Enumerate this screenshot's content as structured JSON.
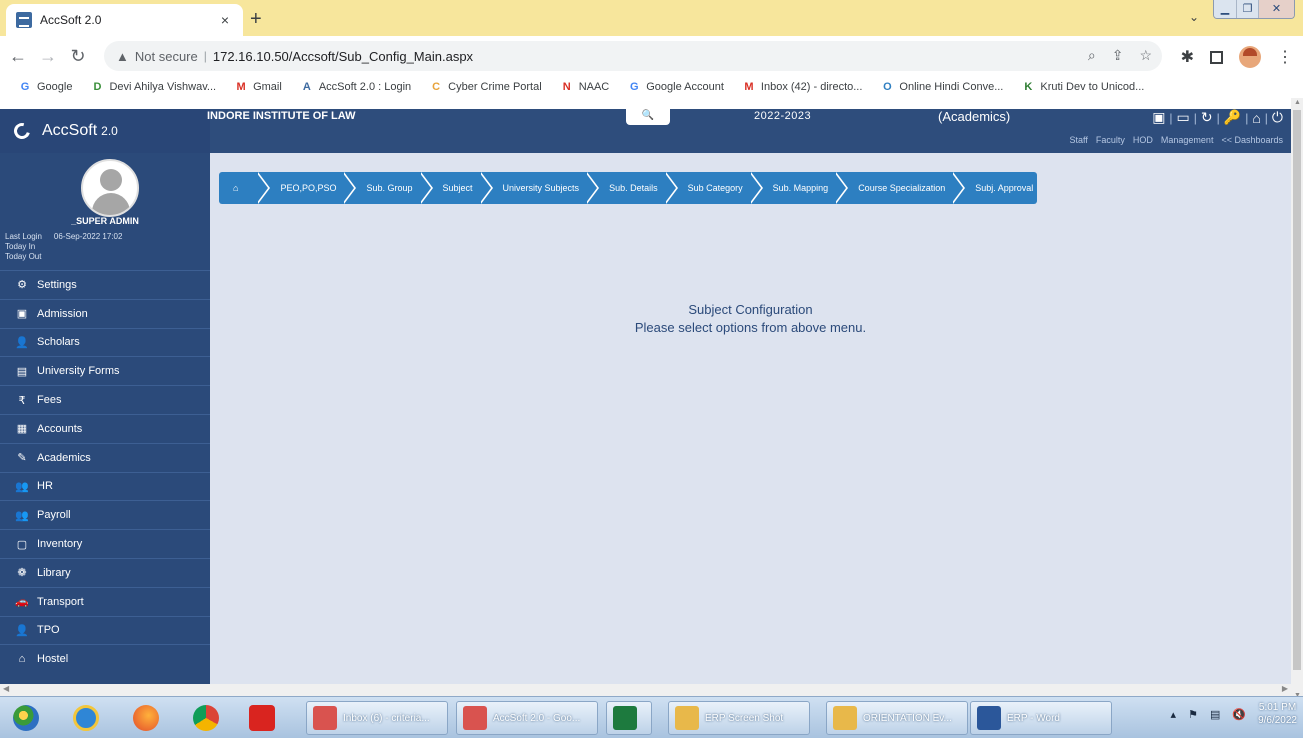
{
  "browser": {
    "tab_title": "AccSoft 2.0",
    "tab_close": "×",
    "new_tab": "+",
    "not_secure": "Not secure",
    "url": "172.16.10.50/Accsoft/Sub_Config_Main.aspx"
  },
  "bookmarks": [
    {
      "label": "Google",
      "icon": "G",
      "color": "#4285f4"
    },
    {
      "label": "Devi Ahilya Vishwav...",
      "icon": "D",
      "color": "#3a8f3a"
    },
    {
      "label": "Gmail",
      "icon": "M",
      "color": "#d93025"
    },
    {
      "label": "AccSoft 2.0 : Login",
      "icon": "A",
      "color": "#3d6aa0"
    },
    {
      "label": "Cyber Crime Portal",
      "icon": "C",
      "color": "#e8a33a"
    },
    {
      "label": "NAAC",
      "icon": "N",
      "color": "#d93025"
    },
    {
      "label": "Google Account",
      "icon": "G",
      "color": "#4285f4"
    },
    {
      "label": "Inbox (42) - directo...",
      "icon": "M",
      "color": "#d93025"
    },
    {
      "label": "Online Hindi Conve...",
      "icon": "O",
      "color": "#2f7fc1"
    },
    {
      "label": "Kruti Dev to Unicod...",
      "icon": "K",
      "color": "#2e7d32"
    }
  ],
  "header": {
    "app_name": "AccSoft",
    "app_version": "2.0",
    "institute": "INDORE INSTITUTE OF LAW",
    "session": "2022-2023",
    "module": "(Academics)",
    "dashboards": [
      "Staff",
      "Faculty",
      "HOD",
      "Management",
      "<< Dashboards"
    ]
  },
  "user": {
    "name": "_SUPER ADMIN",
    "last_login_label": "Last Login",
    "last_login_value": "06-Sep-2022 17:02",
    "today_in_label": "Today In",
    "today_out_label": "Today Out"
  },
  "sidebar": {
    "items": [
      {
        "label": "Settings",
        "icon": "settings-icon",
        "glyph": "⚙"
      },
      {
        "label": "Admission",
        "icon": "admission-icon",
        "glyph": "▣"
      },
      {
        "label": "Scholars",
        "icon": "user-icon",
        "glyph": "👤"
      },
      {
        "label": "University Forms",
        "icon": "form-icon",
        "glyph": "▤"
      },
      {
        "label": "Fees",
        "icon": "rupee-icon",
        "glyph": "₹"
      },
      {
        "label": "Accounts",
        "icon": "accounts-icon",
        "glyph": "▦"
      },
      {
        "label": "Academics",
        "icon": "pencil-icon",
        "glyph": "✎"
      },
      {
        "label": "HR",
        "icon": "users-icon",
        "glyph": "👥"
      },
      {
        "label": "Payroll",
        "icon": "users-icon",
        "glyph": "👥"
      },
      {
        "label": "Inventory",
        "icon": "inventory-icon",
        "glyph": "▢"
      },
      {
        "label": "Library",
        "icon": "library-icon",
        "glyph": "❁"
      },
      {
        "label": "Transport",
        "icon": "car-icon",
        "glyph": "🚗"
      },
      {
        "label": "TPO",
        "icon": "user-icon",
        "glyph": "👤"
      },
      {
        "label": "Hostel",
        "icon": "home-icon",
        "glyph": "⌂"
      }
    ]
  },
  "breadcrumbs": [
    "PEO,PO,PSO",
    "Sub. Group",
    "Subject",
    "University Subjects",
    "Sub. Details",
    "Sub Category",
    "Sub. Mapping",
    "Course Specialization",
    "Subj. Approval"
  ],
  "content": {
    "title": "Subject Configuration",
    "message": "Please select options from above menu."
  },
  "taskbar": {
    "tasks": [
      {
        "label": "Inbox (6) - criteria...",
        "color": "#d9534f"
      },
      {
        "label": "AccSoft 2.0 - Goo...",
        "color": "#d9534f"
      },
      {
        "label": "",
        "color": "#1d7a3e"
      },
      {
        "label": "ERP Screen Shot",
        "color": "#e8b84a"
      },
      {
        "label": "ORIENTATION Ev...",
        "color": "#e8b84a"
      },
      {
        "label": "ERP - Word",
        "color": "#2b579a"
      }
    ],
    "time": "5:01 PM",
    "date": "9/6/2022"
  }
}
